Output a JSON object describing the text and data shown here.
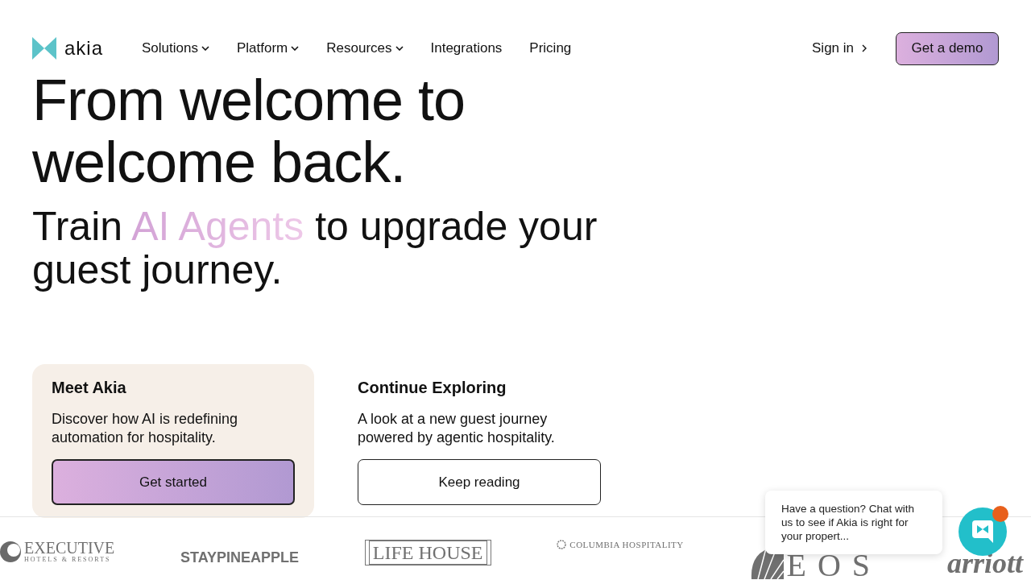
{
  "brand": {
    "name": "akia"
  },
  "nav": [
    {
      "label": "Solutions",
      "dropdown": true
    },
    {
      "label": "Platform",
      "dropdown": true
    },
    {
      "label": "Resources",
      "dropdown": true
    },
    {
      "label": "Integrations",
      "dropdown": false
    },
    {
      "label": "Pricing",
      "dropdown": false
    }
  ],
  "sign_in": "Sign in",
  "cta": "Get a demo",
  "hero": {
    "title": "From welcome to welcome back.",
    "subtitle_before": "Train ",
    "subtitle_highlight": "AI Agents",
    "subtitle_after": " to upgrade your guest journey."
  },
  "cards": [
    {
      "kind": "filled",
      "title": "Meet Akia",
      "text": "Discover how AI is redefining automation for hospitality.",
      "button": "Get started"
    },
    {
      "kind": "plain",
      "title": "Continue Exploring",
      "text": "A look at a new guest journey powered by agentic hospitality.",
      "button": "Keep reading"
    }
  ],
  "logos": [
    {
      "kind": "executive",
      "text": "EXECUTIVE",
      "subtext": "HOTELS & RESORTS"
    },
    {
      "kind": "stay",
      "text": "STAYPINEAPPLE"
    },
    {
      "kind": "boxed",
      "text": "LIFE HOUSE"
    },
    {
      "kind": "columbia",
      "text": "COLUMBIA HOSPITALITY"
    },
    {
      "kind": "eos",
      "text": "EOS"
    },
    {
      "kind": "script",
      "text": "arriott"
    }
  ],
  "chat": {
    "message": "Have a question? Chat with us to see if Akia is right for your propert...",
    "unread": true
  }
}
